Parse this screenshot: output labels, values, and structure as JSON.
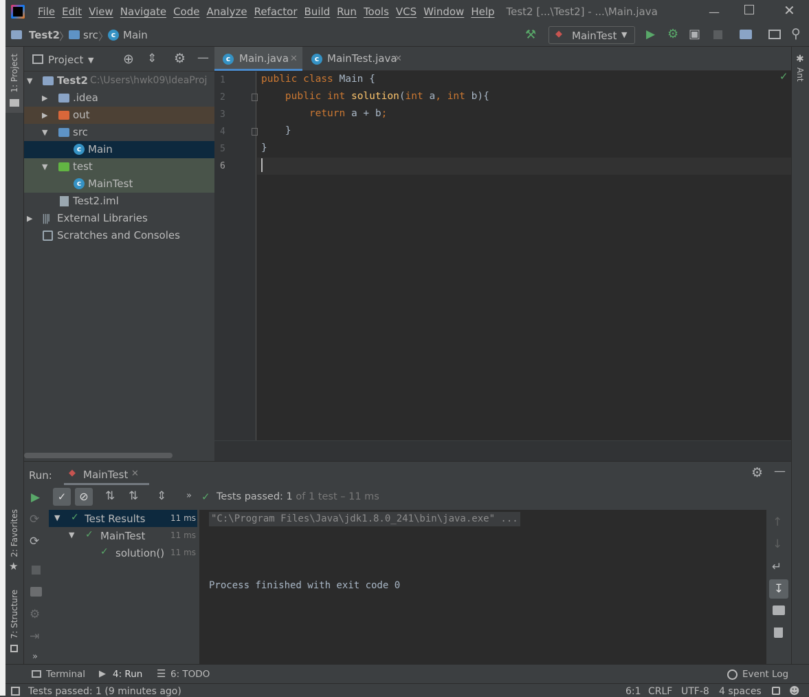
{
  "menu": [
    "File",
    "Edit",
    "View",
    "Navigate",
    "Code",
    "Analyze",
    "Refactor",
    "Build",
    "Run",
    "Tools",
    "VCS",
    "Window",
    "Help"
  ],
  "window_title": "Test2 [...\\Test2] - ...\\Main.java",
  "breadcrumb": {
    "project": "Test2",
    "folder": "src",
    "file": "Main"
  },
  "run_config": "MainTest",
  "project_panel": {
    "title": "Project",
    "root": {
      "name": "Test2",
      "path": "C:\\Users\\hwk09\\IdeaProj"
    },
    "items": [
      ".idea",
      "out",
      "src",
      "Main",
      "test",
      "MainTest",
      "Test2.iml",
      "External Libraries",
      "Scratches and Consoles"
    ]
  },
  "editor": {
    "tabs": [
      "Main.java",
      "MainTest.java"
    ],
    "line_numbers": [
      "1",
      "2",
      "3",
      "4",
      "5",
      "6"
    ]
  },
  "left_strip": {
    "project": "1: Project",
    "favorites": "2: Favorites",
    "structure": "7: Structure"
  },
  "right_strip": {
    "ant": "Ant"
  },
  "run": {
    "label": "Run:",
    "tab": "MainTest",
    "status_prefix": "Tests passed:",
    "status_count": "1",
    "status_suffix": "of 1 test – 11 ms",
    "tree": [
      {
        "name": "Test Results",
        "time": "11 ms"
      },
      {
        "name": "MainTest",
        "time": "11 ms"
      },
      {
        "name": "solution()",
        "time": "11 ms"
      }
    ],
    "console_cmd": "\"C:\\Program Files\\Java\\jdk1.8.0_241\\bin\\java.exe\" ...",
    "console_exit": "Process finished with exit code 0"
  },
  "bottom_tabs": {
    "terminal": "Terminal",
    "run": "4: Run",
    "todo": "6: TODO",
    "event_log": "Event Log"
  },
  "status": {
    "message": "Tests passed: 1 (9 minutes ago)",
    "position": "6:1",
    "line_sep": "CRLF",
    "encoding": "UTF-8",
    "indent": "4 spaces"
  }
}
